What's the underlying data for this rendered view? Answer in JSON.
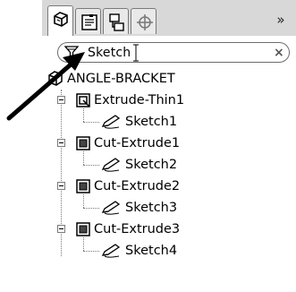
{
  "tabs": [
    {
      "name": "feature-manager-tab",
      "icon": "feature-tree-icon",
      "active": true
    },
    {
      "name": "property-manager-tab",
      "icon": "property-manager-icon",
      "active": false
    },
    {
      "name": "configuration-manager-tab",
      "icon": "configuration-manager-icon",
      "active": false
    },
    {
      "name": "dimxpert-manager-tab",
      "icon": "dimxpert-icon",
      "active": false
    }
  ],
  "tabbar": {
    "more_glyph": "»"
  },
  "filter": {
    "value": "Sketch",
    "clear_glyph": "×",
    "icon": "funnel-icon"
  },
  "tree": {
    "root": {
      "label": "ANGLE-BRACKET",
      "icon": "part-icon"
    },
    "features": [
      {
        "label": "Extrude-Thin1",
        "icon": "extrude-thin-icon",
        "child": {
          "label": "Sketch1",
          "icon": "sketch-icon"
        }
      },
      {
        "label": "Cut-Extrude1",
        "icon": "cut-extrude-icon",
        "child": {
          "label": "Sketch2",
          "icon": "sketch-icon"
        }
      },
      {
        "label": "Cut-Extrude2",
        "icon": "cut-extrude-icon",
        "child": {
          "label": "Sketch3",
          "icon": "sketch-icon"
        }
      },
      {
        "label": "Cut-Extrude3",
        "icon": "cut-extrude-icon",
        "child": {
          "label": "Sketch4",
          "icon": "sketch-icon"
        }
      }
    ]
  },
  "colors": {
    "tabbar_bg": "#d8d8d8",
    "border": "#7a7a7a",
    "arrow": "#000000"
  }
}
